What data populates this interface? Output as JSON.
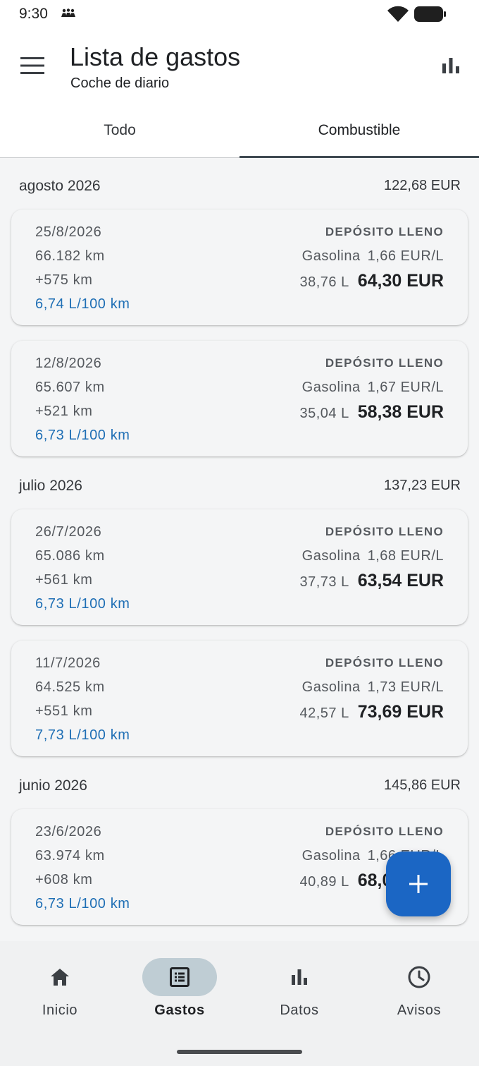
{
  "status_bar": {
    "time": "9:30"
  },
  "header": {
    "title": "Lista de gastos",
    "subtitle": "Coche de diario"
  },
  "tabs": [
    {
      "label": "Todo",
      "active": false
    },
    {
      "label": "Combustible",
      "active": true
    }
  ],
  "months": [
    {
      "name": "agosto 2026",
      "total": "122,68 EUR"
    },
    {
      "name": "julio 2026",
      "total": "137,23 EUR"
    },
    {
      "name": "junio 2026",
      "total": "145,86 EUR"
    }
  ],
  "entries": [
    {
      "date": "25/8/2026",
      "odometer": "66.182 km",
      "distance": "+575 km",
      "consumption": "6,74 L/100 km",
      "full_tank": "DEPÓSITO LLENO",
      "fuel": "Gasolina",
      "unit_price": "1,66 EUR/L",
      "liters": "38,76 L",
      "price": "64,30 EUR"
    },
    {
      "date": "12/8/2026",
      "odometer": "65.607 km",
      "distance": "+521 km",
      "consumption": "6,73 L/100 km",
      "full_tank": "DEPÓSITO LLENO",
      "fuel": "Gasolina",
      "unit_price": "1,67 EUR/L",
      "liters": "35,04 L",
      "price": "58,38 EUR"
    },
    {
      "date": "26/7/2026",
      "odometer": "65.086 km",
      "distance": "+561 km",
      "consumption": "6,73 L/100 km",
      "full_tank": "DEPÓSITO LLENO",
      "fuel": "Gasolina",
      "unit_price": "1,68 EUR/L",
      "liters": "37,73 L",
      "price": "63,54 EUR"
    },
    {
      "date": "11/7/2026",
      "odometer": "64.525 km",
      "distance": "+551 km",
      "consumption": "7,73 L/100 km",
      "full_tank": "DEPÓSITO LLENO",
      "fuel": "Gasolina",
      "unit_price": "1,73 EUR/L",
      "liters": "42,57 L",
      "price": "73,69 EUR"
    },
    {
      "date": "23/6/2026",
      "odometer": "63.974 km",
      "distance": "+608 km",
      "consumption": "6,73 L/100 km",
      "full_tank": "DEPÓSITO LLENO",
      "fuel": "Gasolina",
      "unit_price": "1,66 EUR/L",
      "liters": "40,89 L",
      "price": "68,00 EUR"
    }
  ],
  "fab": {
    "icon": "plus-icon",
    "color": "#1b66c4"
  },
  "bottom_nav": [
    {
      "label": "Inicio",
      "icon": "home-icon",
      "active": false
    },
    {
      "label": "Gastos",
      "icon": "receipt-list-icon",
      "active": true
    },
    {
      "label": "Datos",
      "icon": "bar-chart-icon",
      "active": false
    },
    {
      "label": "Avisos",
      "icon": "clock-icon",
      "active": false
    }
  ],
  "colors": {
    "accent": "#1b66c4",
    "consumption_text": "#1f6fb5",
    "active_nav_pill": "#bfcdd4"
  }
}
